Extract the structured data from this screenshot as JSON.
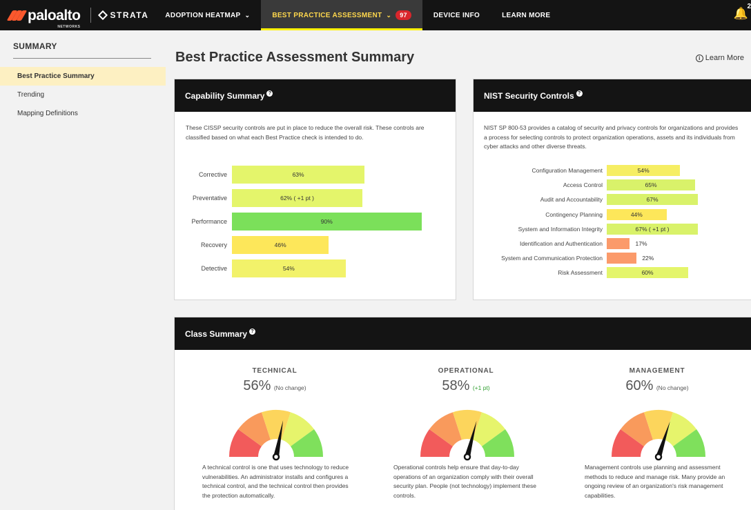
{
  "brand": {
    "name": "paloalto",
    "sub": "NETWORKS",
    "product": "STRATA"
  },
  "nav": {
    "items": [
      {
        "label": "ADOPTION HEATMAP",
        "has_dropdown": true,
        "active": false
      },
      {
        "label": "BEST PRACTICE ASSESSMENT",
        "has_dropdown": true,
        "active": true,
        "badge": "97"
      },
      {
        "label": "DEVICE INFO",
        "has_dropdown": false,
        "active": false
      },
      {
        "label": "LEARN MORE",
        "has_dropdown": false,
        "active": false
      }
    ],
    "notification_count": "2",
    "icons": [
      "chevron-down-icon",
      "bell-icon"
    ]
  },
  "sidebar": {
    "title": "SUMMARY",
    "items": [
      {
        "label": "Best Practice Summary",
        "active": true
      },
      {
        "label": "Trending",
        "active": false
      },
      {
        "label": "Mapping Definitions",
        "active": false
      }
    ]
  },
  "page": {
    "title": "Best Practice Assessment Summary",
    "learn_more": "Learn More"
  },
  "capability": {
    "title": "Capability Summary",
    "description": "These CISSP security controls are put in place to reduce the overall risk. These controls are classified based on what each Best Practice check is intended to do.",
    "rows": [
      {
        "label": "Corrective",
        "value": 63,
        "text": "63%",
        "color": "#e4f56b"
      },
      {
        "label": "Preventative",
        "value": 62,
        "text": "62% ( +1 pt )",
        "color": "#e4f56b"
      },
      {
        "label": "Performance",
        "value": 90,
        "text": "90%",
        "color": "#7be05a"
      },
      {
        "label": "Recovery",
        "value": 46,
        "text": "46%",
        "color": "#fde75a"
      },
      {
        "label": "Detective",
        "value": 54,
        "text": "54%",
        "color": "#f2f26a"
      }
    ]
  },
  "nist": {
    "title": "NIST Security Controls",
    "description": "NIST SP 800-53 provides a catalog of security and privacy controls for organizations and provides a process for selecting controls to protect organization operations, assets and its individuals from cyber attacks and other diverse threats.",
    "rows": [
      {
        "label": "Configuration Management",
        "value": 54,
        "text": "54%",
        "color": "#f6ee63"
      },
      {
        "label": "Access Control",
        "value": 65,
        "text": "65%",
        "color": "#d9f26a"
      },
      {
        "label": "Audit and Accountability",
        "value": 67,
        "text": "67%",
        "color": "#d9f26a"
      },
      {
        "label": "Contingency Planning",
        "value": 44,
        "text": "44%",
        "color": "#fde75a"
      },
      {
        "label": "System and Information Integrity",
        "value": 67,
        "text": "67% ( +1 pt )",
        "color": "#d9f26a"
      },
      {
        "label": "Identification and Authentication",
        "value": 17,
        "text": "17%",
        "color": "#fb9a6a"
      },
      {
        "label": "System and Communication Protection",
        "value": 22,
        "text": "22%",
        "color": "#fb9a6a"
      },
      {
        "label": "Risk Assessment",
        "value": 60,
        "text": "60%",
        "color": "#e4f56b"
      }
    ]
  },
  "class_summary": {
    "title": "Class Summary",
    "items": [
      {
        "name": "TECHNICAL",
        "percent": "56%",
        "change": "(No change)",
        "change_up": false,
        "value": 56,
        "description": "A technical control is one that uses technology to reduce vulnerabilities. An administrator installs and configures a technical control, and the technical control then provides the protection automatically."
      },
      {
        "name": "OPERATIONAL",
        "percent": "58%",
        "change": "(+1 pt)",
        "change_up": true,
        "value": 58,
        "description": "Operational controls help ensure that day-to-day operations of an organization comply with their overall security plan. People (not technology) implement these controls."
      },
      {
        "name": "MANAGEMENT",
        "percent": "60%",
        "change": "(No change)",
        "change_up": false,
        "value": 60,
        "description": "Management controls use planning and assessment methods to reduce and manage risk. Many provide an ongoing review of an organization's risk management capabilities."
      }
    ],
    "gauge_colors": [
      "#f25b5b",
      "#f99a5c",
      "#fcd55c",
      "#e6f46c",
      "#7fe05c"
    ]
  }
}
